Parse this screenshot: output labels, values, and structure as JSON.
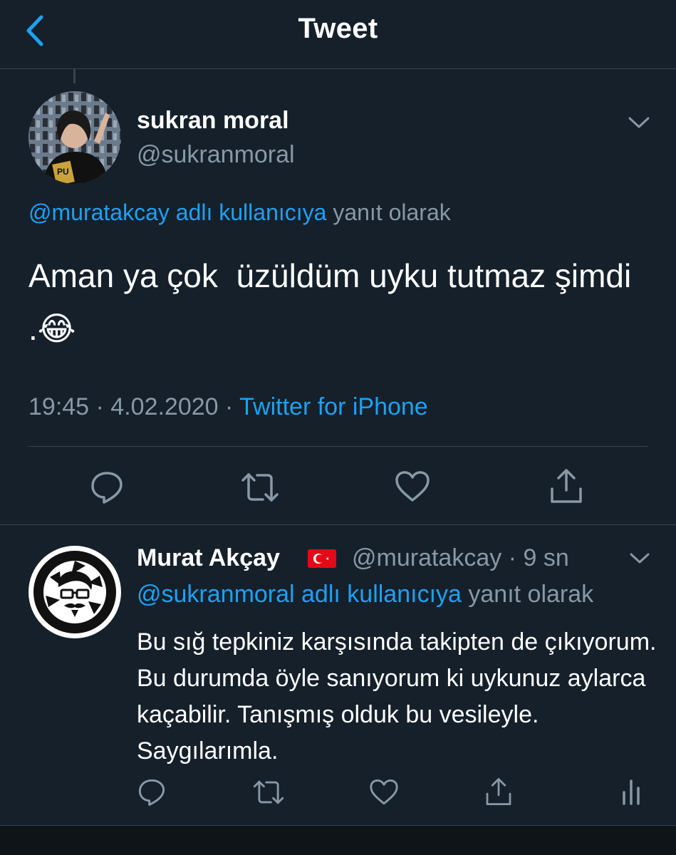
{
  "header": {
    "title": "Tweet"
  },
  "tweet": {
    "author_name": "sukran moral",
    "author_handle": "@sukranmoral",
    "reply_to_handle": "@muratakcay adlı kullanıcıya",
    "reply_to_suffix": " yanıt olarak",
    "text": "Aman ya çok  üzüldüm uyku tutmaz şimdi .😂",
    "time": "19:45 · 4.02.2020 · ",
    "source": "Twitter for iPhone"
  },
  "reply": {
    "author_name": "Murat Akçay",
    "author_handle": "@muratakcay · 9 sn",
    "reply_to_handle": "@sukranmoral adlı kullanıcıya",
    "reply_to_suffix": " yanıt olarak",
    "text": "Bu sığ tepkiniz karşısında takipten de çıkıyorum. Bu durumda öyle sanıyorum ki uykunuz aylarca kaçabilir. Tanışmış olduk bu vesileyle. Saygılarımla."
  },
  "icons": {
    "back": "chevron-left-icon",
    "more": "chevron-down-icon",
    "reply": "comment-icon",
    "retweet": "retweet-icon",
    "like": "heart-icon",
    "share": "share-icon",
    "analytics": "analytics-icon",
    "flag": "turkey-flag-icon"
  },
  "colors": {
    "background": "#15202b",
    "accent": "#1da1f2",
    "secondary_text": "#8899a6",
    "divider": "#38444d"
  }
}
